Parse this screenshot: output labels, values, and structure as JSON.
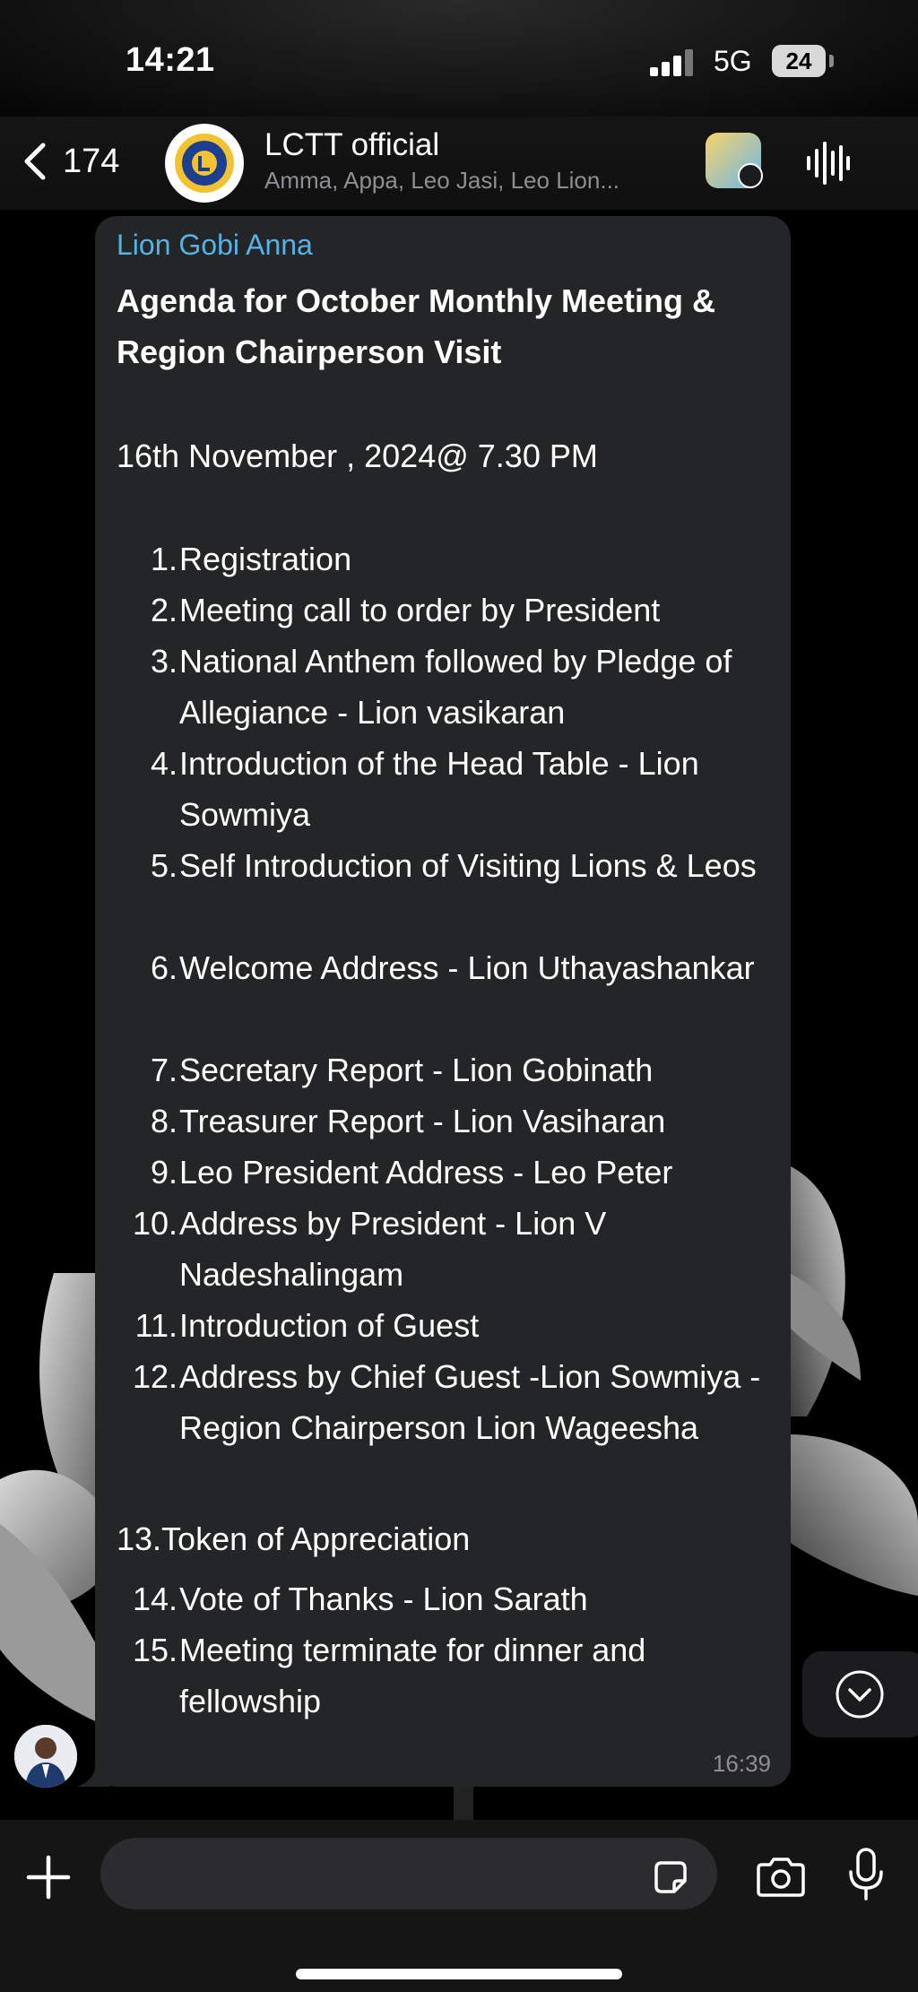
{
  "status_bar": {
    "time": "14:21",
    "network": "5G",
    "battery": "24"
  },
  "header": {
    "back_count": "174",
    "group_name": "LCTT official",
    "members": "Amma, Appa, Leo Jasi, Leo Lion..."
  },
  "message": {
    "sender": "Lion Gobi Anna",
    "heading": "Agenda for October Monthly Meeting & Region Chairperson Visit",
    "date_line": "16th November , 2024@ 7.30 PM",
    "items": [
      {
        "num": "1.",
        "text": "Registration"
      },
      {
        "num": "2.",
        "text": "Meeting call to order by President"
      },
      {
        "num": "3.",
        "text": "National Anthem followed by Pledge of Allegiance  - Lion vasikaran"
      },
      {
        "num": "4.",
        "text": "Introduction of the Head Table - Lion Sowmiya"
      },
      {
        "num": "5.",
        "text": "Self Introduction of Visiting Lions & Leos"
      },
      {
        "num": "6.",
        "text": "Welcome Address - Lion Uthayashankar"
      },
      {
        "num": "7.",
        "text": "Secretary Report - Lion Gobinath"
      },
      {
        "num": "8.",
        "text": "Treasurer Report - Lion Vasiharan"
      },
      {
        "num": "9.",
        "text": "Leo President Address - Leo Peter"
      },
      {
        "num": "10.",
        "text": "Address by President - Lion V Nadeshalingam"
      },
      {
        "num": "11.",
        "text": "Introduction of Guest"
      },
      {
        "num": "12.",
        "text": "Address by Chief Guest -Lion Sowmiya - Region Chairperson Lion Wageesha"
      },
      {
        "num": "13.",
        "text": "Token of Appreciation"
      },
      {
        "num": "14.",
        "text": "Vote of Thanks - Lion Sarath"
      },
      {
        "num": "15.",
        "text": "Meeting terminate for dinner and fellowship"
      }
    ],
    "time": "16:39"
  },
  "input": {
    "placeholder": ""
  },
  "icons": {
    "back": "chevron-left-icon",
    "voice_call": "waveform-icon",
    "add": "plus-icon",
    "sticker": "sticker-icon",
    "camera": "camera-icon",
    "mic": "microphone-icon",
    "scroll": "chevron-down-circle-icon"
  },
  "colors": {
    "sender_name": "#54b3e6",
    "bubble": "#242526",
    "timestamp": "#8e8e93"
  }
}
